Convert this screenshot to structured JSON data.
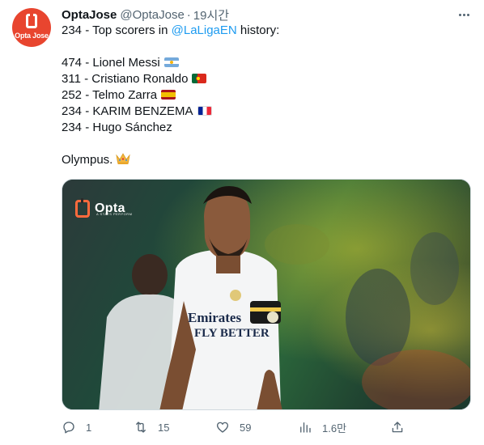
{
  "tweet": {
    "avatar_text": "Opta Jose",
    "display_name": "OptaJose",
    "handle": "@OptaJose",
    "separator": "·",
    "time": "19시간",
    "line1_prefix": "234 - Top scorers in ",
    "line1_mention": "@LaLigaEN",
    "line1_suffix": " history:",
    "scorers": [
      {
        "text": "474 - Lionel Messi",
        "flag": "argentina-flag"
      },
      {
        "text": "311 - Cristiano Ronaldo",
        "flag": "portugal-flag"
      },
      {
        "text": "252 - Telmo Zarra",
        "flag": "spain-flag"
      },
      {
        "text": "234 - KARIM BENZEMA",
        "flag": "france-flag"
      },
      {
        "text": "234 - Hugo Sánchez",
        "flag": null
      }
    ],
    "closing": "Olympus.",
    "closing_emoji": "crown-emoji"
  },
  "media": {
    "logo_text": "Opta",
    "logo_subtext": "A STATS PERFORM",
    "description": "Karim Benzema in Real Madrid kit"
  },
  "actions": {
    "reply_count": "1",
    "retweet_count": "15",
    "like_count": "59",
    "views_count": "1.6만",
    "icons": [
      "reply-icon",
      "retweet-icon",
      "like-icon",
      "views-icon",
      "share-icon"
    ]
  },
  "colors": {
    "accent": "#1d9bf0",
    "muted": "#536471",
    "avatar": "#e8452f",
    "opta_orange": "#ff6a3d"
  }
}
